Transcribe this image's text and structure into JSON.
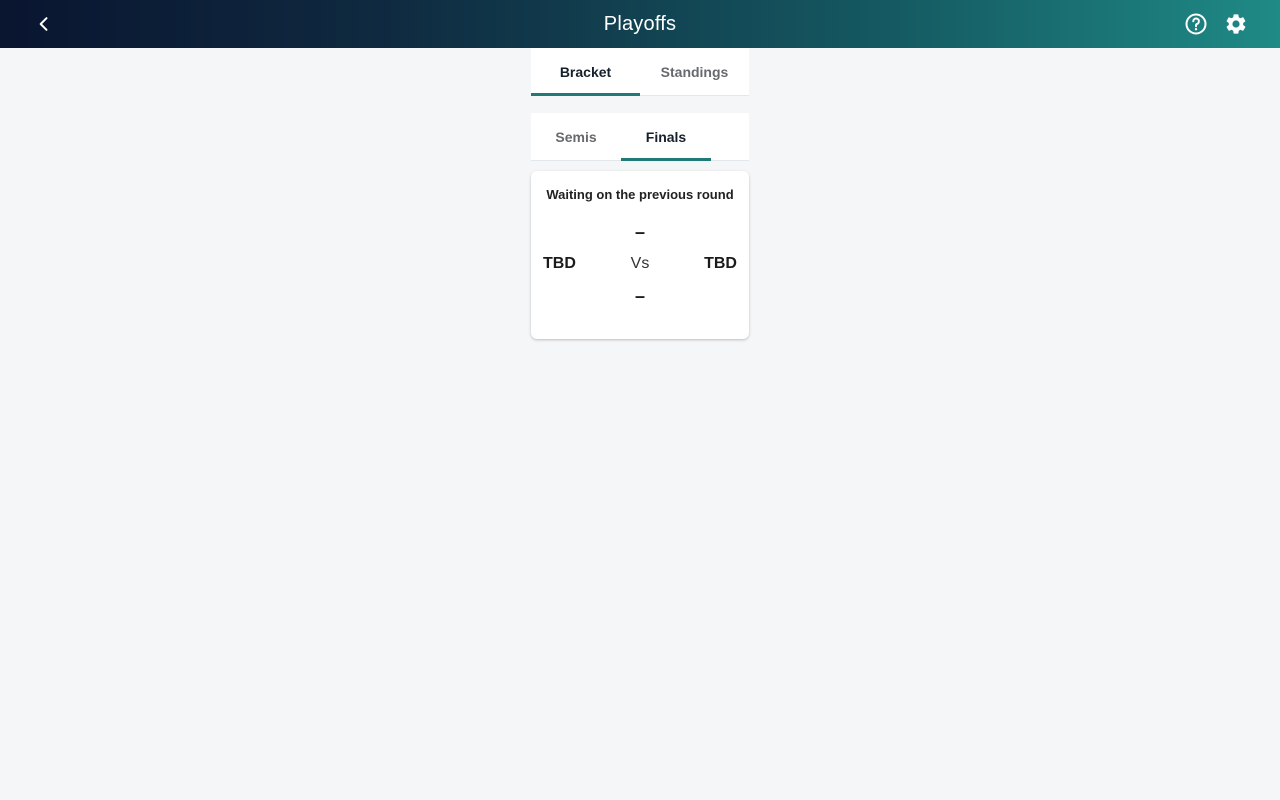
{
  "header": {
    "title": "Playoffs",
    "back_icon": "chevron-left-icon",
    "help_icon": "help-circle-icon",
    "settings_icon": "gear-icon"
  },
  "tabs": [
    {
      "label": "Bracket",
      "active": true
    },
    {
      "label": "Standings",
      "active": false
    }
  ],
  "rounds": [
    {
      "label": "Semis",
      "active": false
    },
    {
      "label": "Finals",
      "active": true
    }
  ],
  "match": {
    "status": "Waiting on the previous round",
    "score_home": "–",
    "score_away": "–",
    "team_home": "TBD",
    "team_away": "TBD",
    "vs_label": "Vs"
  },
  "colors": {
    "accent": "#1f7a78",
    "header_start": "#0a1530",
    "header_end": "#1f8a86",
    "background": "#f4f6f8"
  }
}
